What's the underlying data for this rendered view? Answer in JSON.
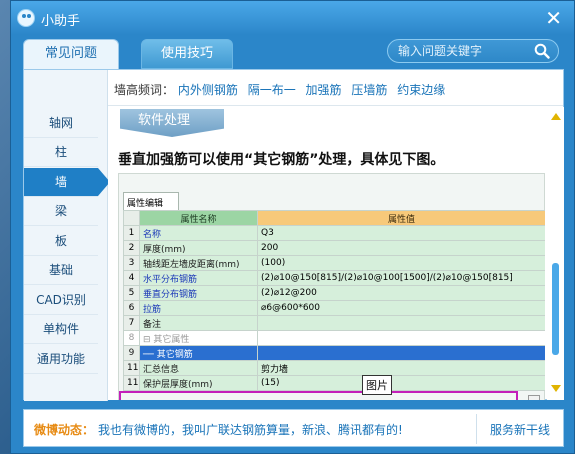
{
  "window": {
    "title": "小助手",
    "close_label": "✕"
  },
  "tabs": [
    {
      "label": "常见问题",
      "active": true
    },
    {
      "label": "使用技巧",
      "active": false
    }
  ],
  "search": {
    "placeholder": "输入问题关键字",
    "icon": "search-icon"
  },
  "hot_words": {
    "label": "墙高频词：",
    "items": [
      "内外侧钢筋",
      "隔一布一",
      "加强筋",
      "压墙筋",
      "约束边缘"
    ]
  },
  "sidebar": {
    "items": [
      {
        "label": "轴网"
      },
      {
        "label": "柱"
      },
      {
        "label": "墙",
        "active": true
      },
      {
        "label": "梁"
      },
      {
        "label": "板"
      },
      {
        "label": "基础"
      },
      {
        "label": "CAD识别"
      },
      {
        "label": "单构件"
      },
      {
        "label": "通用功能"
      }
    ]
  },
  "doc": {
    "section_tag": "软件处理",
    "heading": "垂直加强筋可以使用“其它钢筋”处理，具体见下图。",
    "sheet_tab": "属性编辑",
    "table": {
      "headers": [
        "",
        "属性名称",
        "属性值"
      ],
      "rows": [
        [
          "1",
          "名称",
          "Q3"
        ],
        [
          "2",
          "厚度(mm)",
          "200"
        ],
        [
          "3",
          "轴线距左墙皮距离(mm)",
          "(100)"
        ],
        [
          "4",
          "水平分布钢筋",
          "(2)⌀10@150[815]/(2)⌀10@100[1500]/(2)⌀10@150[815]"
        ],
        [
          "5",
          "垂直分布钢筋",
          "(2)⌀12@200"
        ],
        [
          "6",
          "拉筋",
          "⌀6@600*600"
        ],
        [
          "7",
          "备注",
          ""
        ],
        [
          "8",
          "⊟ 其它属性",
          ""
        ],
        [
          "9",
          "── 其它钢筋",
          ""
        ],
        [
          "11",
          "汇总信息",
          "剪力墙"
        ],
        [
          "11",
          "保护层厚度(mm)",
          "(15)"
        ]
      ]
    },
    "tooltip": "图片",
    "ellipsis": "..."
  },
  "footer": {
    "weibo_label": "微博动态：",
    "weibo_text": "我也有微博的，我叫广联达钢筋算量，新浪、腾讯都有的!",
    "service_link": "服务新干线"
  }
}
